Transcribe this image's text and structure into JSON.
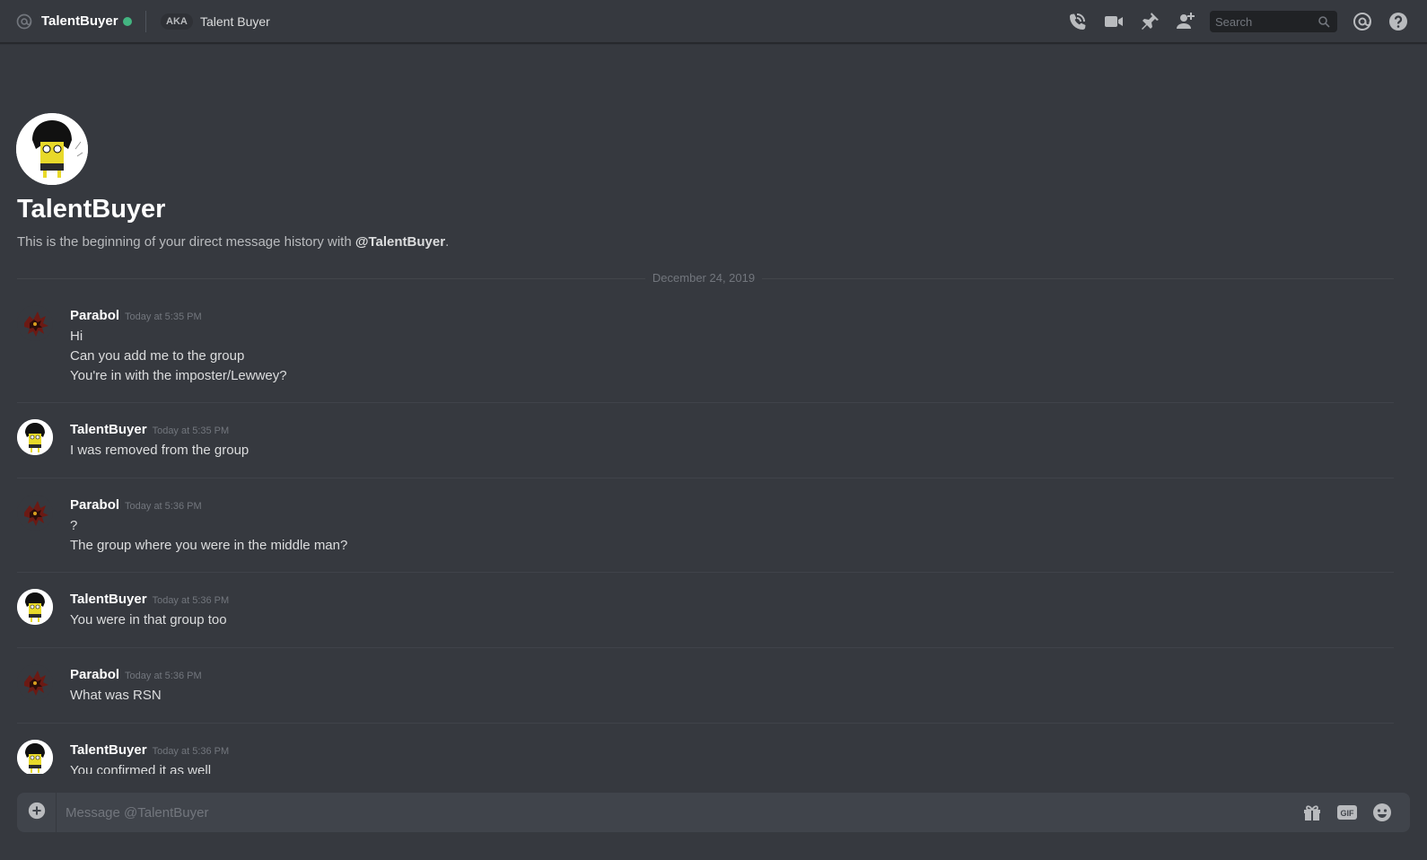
{
  "header": {
    "dm_name": "TalentBuyer",
    "aka_label": "AKA",
    "nickname": "Talent Buyer",
    "status_color": "#43b581",
    "icons": [
      "phone-call-icon",
      "video-icon",
      "pin-icon",
      "add-friend-icon",
      "mention-icon",
      "help-icon"
    ],
    "search_placeholder": "Search"
  },
  "intro": {
    "name": "TalentBuyer",
    "desc_prefix": "This is the beginning of your direct message history with ",
    "desc_user": "@TalentBuyer",
    "desc_suffix": "."
  },
  "date_divider": "December 24, 2019",
  "messages": [
    {
      "author": "Parabol",
      "time": "Today at 5:35 PM",
      "lines": [
        "Hi",
        "Can you add me to the group",
        "You're in with the imposter/Lewwey?"
      ]
    },
    {
      "author": "TalentBuyer",
      "time": "Today at 5:35 PM",
      "lines": [
        "I was removed from the group"
      ]
    },
    {
      "author": "Parabol",
      "time": "Today at 5:36 PM",
      "lines": [
        "?",
        "The group where you were in the middle man?"
      ]
    },
    {
      "author": "TalentBuyer",
      "time": "Today at 5:36 PM",
      "lines": [
        "You were in that group too"
      ]
    },
    {
      "author": "Parabol",
      "time": "Today at 5:36 PM",
      "lines": [
        "What was RSN"
      ]
    },
    {
      "author": "TalentBuyer",
      "time": "Today at 5:36 PM",
      "lines": [
        "You confirmed it as well"
      ]
    }
  ],
  "composer": {
    "placeholder": "Message @TalentBuyer",
    "gif_label": "GIF"
  }
}
